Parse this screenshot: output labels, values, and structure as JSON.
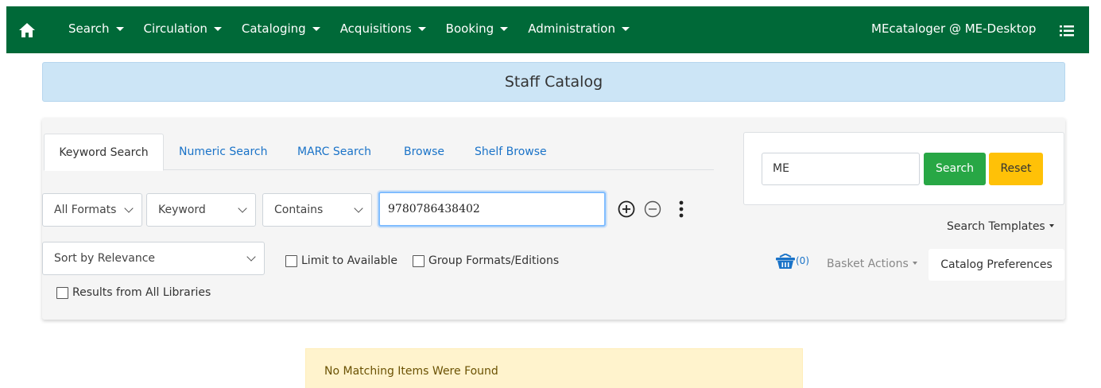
{
  "nav": {
    "menu": [
      {
        "label": "Search",
        "name": "nav-search"
      },
      {
        "label": "Circulation",
        "name": "nav-circulation"
      },
      {
        "label": "Cataloging",
        "name": "nav-cataloging"
      },
      {
        "label": "Acquisitions",
        "name": "nav-acquisitions"
      },
      {
        "label": "Booking",
        "name": "nav-booking"
      },
      {
        "label": "Administration",
        "name": "nav-administration"
      }
    ],
    "user": "MEcataloger @ ME-Desktop",
    "home_icon": "home-icon",
    "list_icon": "list-icon",
    "bg_color": "#006938"
  },
  "banner": {
    "title": "Staff Catalog"
  },
  "tabs": [
    {
      "label": "Keyword Search",
      "active": true
    },
    {
      "label": "Numeric Search"
    },
    {
      "label": "MARC Search"
    },
    {
      "label": "Browse"
    },
    {
      "label": "Shelf Browse"
    }
  ],
  "search_row": {
    "format": "All Formats",
    "field": "Keyword",
    "match": "Contains",
    "query": "9780786438402"
  },
  "sort": {
    "value": "Sort by Relevance"
  },
  "checkboxes": {
    "limit_available": "Limit to Available",
    "group_formats": "Group Formats/Editions",
    "all_libraries": "Results from All Libraries"
  },
  "quick_search": {
    "value": "ME",
    "search_label": "Search",
    "reset_label": "Reset",
    "search_color": "#28a745",
    "reset_color": "#ffc107"
  },
  "search_templates": "Search Templates",
  "basket": {
    "count": "(0)",
    "actions": "Basket Actions",
    "icon": "basket-icon"
  },
  "catalog_prefs": "Catalog Preferences",
  "alert": {
    "message": "No Matching Items Were Found"
  }
}
